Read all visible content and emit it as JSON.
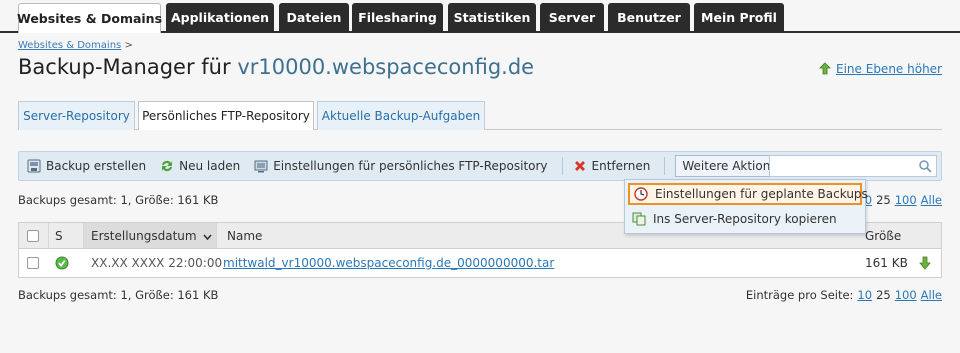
{
  "nav": {
    "tabs": [
      {
        "label": "Websites & Domains",
        "active": true
      },
      {
        "label": "Applikationen"
      },
      {
        "label": "Dateien"
      },
      {
        "label": "Filesharing"
      },
      {
        "label": "Statistiken"
      },
      {
        "label": "Server"
      },
      {
        "label": "Benutzer"
      },
      {
        "label": "Mein Profil"
      }
    ]
  },
  "breadcrumb": {
    "link": "Websites & Domains",
    "sep": ">"
  },
  "page": {
    "title_prefix": "Backup-Manager für",
    "title_host": "vr10000.webspaceconfig.de",
    "up_link": "Eine Ebene höher"
  },
  "subtabs": [
    {
      "label": "Server-Repository"
    },
    {
      "label": "Persönliches FTP-Repository",
      "active": true
    },
    {
      "label": "Aktuelle Backup-Aufgaben"
    }
  ],
  "toolbar": {
    "create": "Backup erstellen",
    "reload": "Neu laden",
    "settings": "Einstellungen für persönliches FTP-Repository",
    "remove": "Entfernen",
    "more": "Weitere Aktionen",
    "search_placeholder": ""
  },
  "menu": {
    "items": [
      {
        "label": "Einstellungen für geplante Backups",
        "highlighted": true,
        "icon": "clock-icon"
      },
      {
        "label": "Ins Server-Repository kopieren",
        "icon": "copy-icon"
      }
    ]
  },
  "summary": {
    "text": "Backups gesamt: 1, Größe: 161 KB"
  },
  "pager": {
    "label": "Einträge pro Seite:",
    "options": [
      "10",
      "25",
      "100",
      "Alle"
    ],
    "current": "25"
  },
  "table": {
    "headers": {
      "status": "S",
      "date": "Erstellungsdatum",
      "name": "Name",
      "size": "Größe"
    },
    "rows": [
      {
        "status": "ok",
        "date": "XX.XX XXXX 22:00:00",
        "name": "mittwald_vr10000.webspaceconfig.de_0000000000.tar",
        "size": "161 KB"
      }
    ]
  },
  "colors": {
    "nav_bg": "#2b2b2b",
    "link": "#2a78b8",
    "toolbar_bg": "#dfeaf3",
    "highlight": "#e8922a"
  }
}
